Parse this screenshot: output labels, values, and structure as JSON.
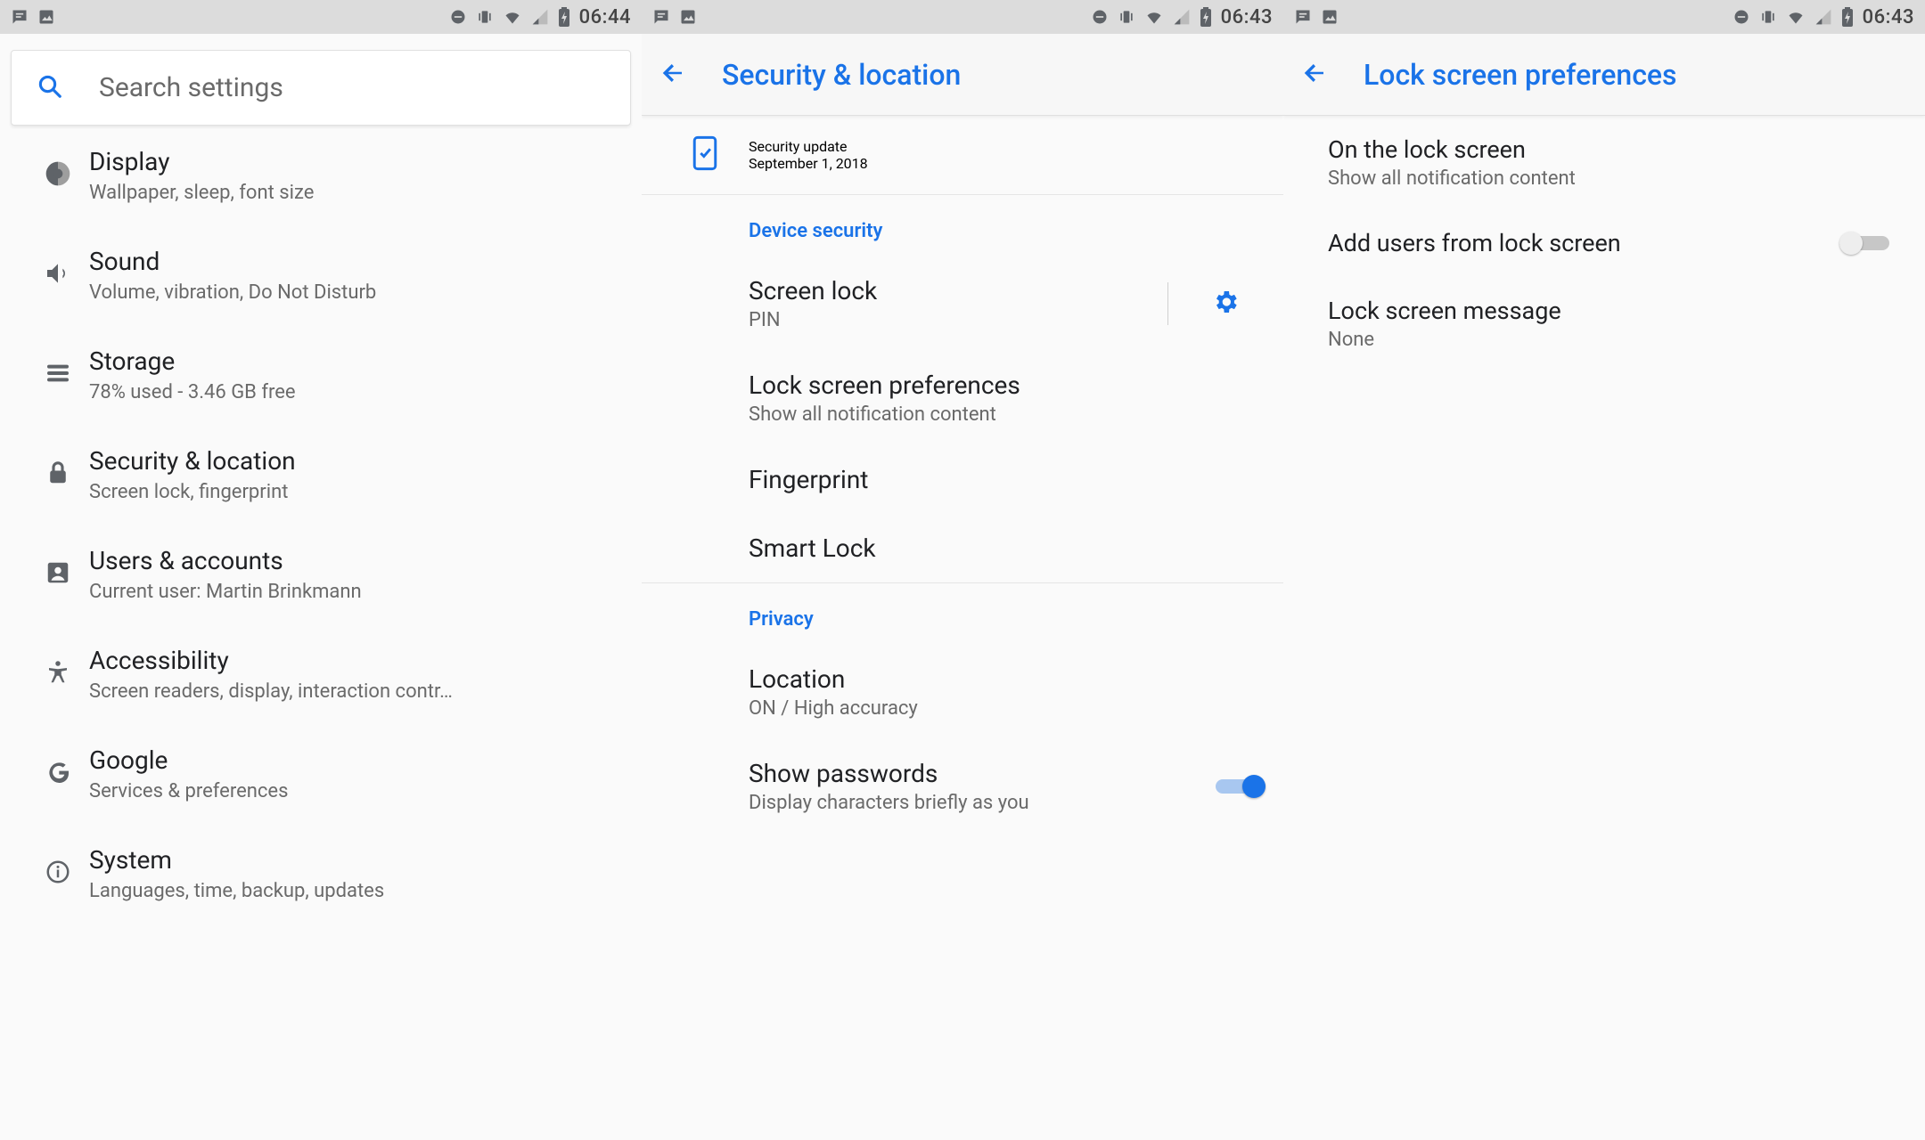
{
  "screen1": {
    "statusbar": {
      "time": "06:44"
    },
    "search": {
      "placeholder": "Search settings"
    },
    "items": [
      {
        "title": "Display",
        "sub": "Wallpaper, sleep, font size"
      },
      {
        "title": "Sound",
        "sub": "Volume, vibration, Do Not Disturb"
      },
      {
        "title": "Storage",
        "sub": "78% used - 3.46 GB free"
      },
      {
        "title": "Security & location",
        "sub": "Screen lock, fingerprint"
      },
      {
        "title": "Users & accounts",
        "sub": "Current user: Martin Brinkmann"
      },
      {
        "title": "Accessibility",
        "sub": "Screen readers, display, interaction contr…"
      },
      {
        "title": "Google",
        "sub": "Services & preferences"
      },
      {
        "title": "System",
        "sub": "Languages, time, backup, updates"
      }
    ]
  },
  "screen2": {
    "statusbar": {
      "time": "06:43"
    },
    "title": "Security & location",
    "update": {
      "title": "Security update",
      "sub": "September 1, 2018"
    },
    "section_device": "Device security",
    "screen_lock": {
      "title": "Screen lock",
      "sub": "PIN"
    },
    "lock_prefs": {
      "title": "Lock screen preferences",
      "sub": "Show all notification content"
    },
    "fingerprint": {
      "title": "Fingerprint"
    },
    "smart_lock": {
      "title": "Smart Lock"
    },
    "section_privacy": "Privacy",
    "location": {
      "title": "Location",
      "sub": "ON / High accuracy"
    },
    "show_passwords": {
      "title": "Show passwords",
      "sub": "Display characters briefly as you"
    }
  },
  "screen3": {
    "statusbar": {
      "time": "06:43"
    },
    "title": "Lock screen preferences",
    "on_lock": {
      "title": "On the lock screen",
      "sub": "Show all notification content"
    },
    "add_users": {
      "title": "Add users from lock screen"
    },
    "message": {
      "title": "Lock screen message",
      "sub": "None"
    }
  }
}
